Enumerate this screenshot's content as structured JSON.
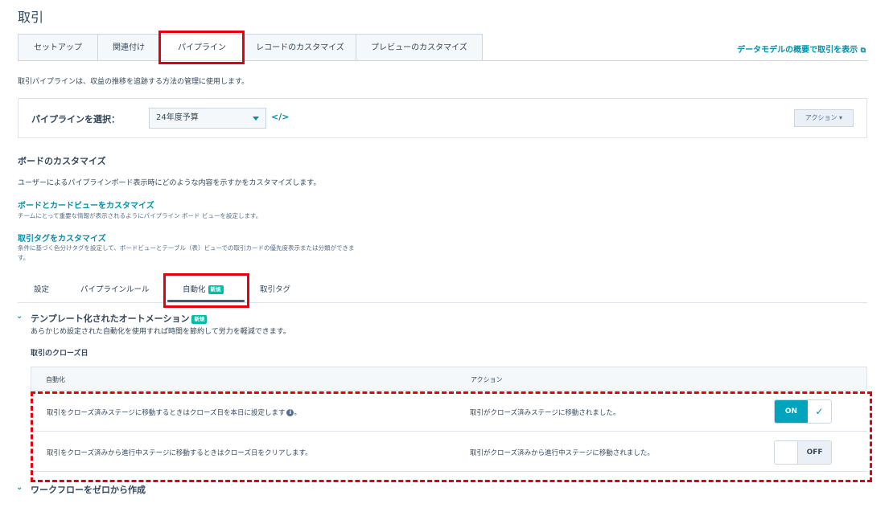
{
  "page": {
    "title": "取引"
  },
  "tabs": [
    {
      "label": "セットアップ"
    },
    {
      "label": "関連付け"
    },
    {
      "label": "パイプライン"
    },
    {
      "label": "レコードのカスタマイズ"
    },
    {
      "label": "プレビューのカスタマイズ"
    }
  ],
  "external_link": {
    "label": "データモデルの概要で取引を表示",
    "icon": "external-link-icon"
  },
  "description": "取引パイプラインは、収益の推移を追跡する方法の管理に使用します。",
  "pipeline": {
    "label": "パイプラインを選択：",
    "selected": "24年度予算",
    "code_icon": "</>",
    "action_label": "アクション ▾"
  },
  "board": {
    "heading": "ボードのカスタマイズ",
    "description": "ユーザーによるパイプラインボード表示時にどのような内容を示すかをカスタマイズします。",
    "link1": "ボードとカードビューをカスタマイズ",
    "link1_desc": "チームにとって重要な情報が表示されるようにパイプライン ボード ビューを設定します。",
    "link2": "取引タグをカスタマイズ",
    "link2_desc": "条件に基づく色分けタグを設定して、ボードビューとテーブル（表）ビューでの取引カードの優先度表示または分類ができます。"
  },
  "subtabs": [
    {
      "label": "設定"
    },
    {
      "label": "パイプラインルール"
    },
    {
      "label": "自動化",
      "badge": "新規"
    },
    {
      "label": "取引タグ"
    }
  ],
  "templates": {
    "heading": "テンプレート化されたオートメーション",
    "badge": "新規",
    "description": "あらかじめ設定された自動化を使用すれば時間を節約して労力を軽減できます。",
    "group_heading": "取引のクローズ日",
    "columns": {
      "automation": "自動化",
      "action": "アクション"
    },
    "rows": [
      {
        "automation": "取引をクローズ済みステージに移動するときはクローズ日を本日に設定します",
        "action": "取引がクローズ済みステージに移動されました。",
        "state": "ON",
        "state_icon": "check-icon"
      },
      {
        "automation": "取引をクローズ済みから進行中ステージに移動するときはクローズ日をクリアします。",
        "action": "取引がクローズ済みから進行中ステージに移動されました。",
        "state": "OFF"
      }
    ]
  },
  "workflow": {
    "heading": "ワークフローをゼロから作成"
  }
}
